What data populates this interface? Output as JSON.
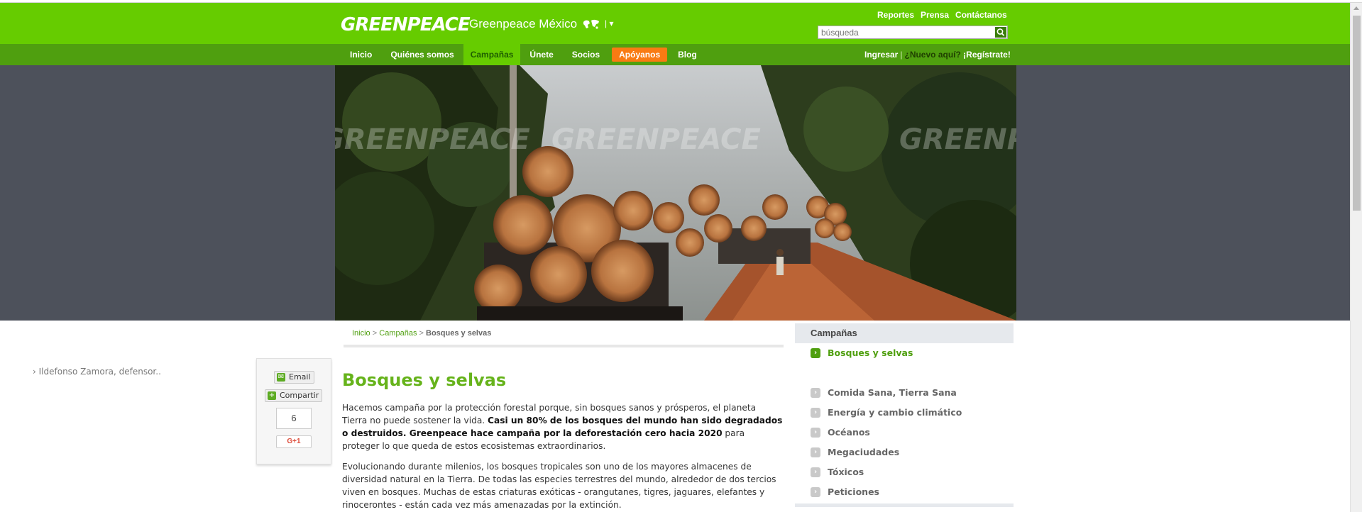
{
  "header": {
    "logo": "GREENPEACE",
    "site_name": "Greenpeace México",
    "globe_icon": "globe-icon",
    "top_links": [
      "Reportes",
      "Prensa",
      "Contáctanos"
    ],
    "search_placeholder": "búsqueda"
  },
  "nav": {
    "items": [
      "Inicio",
      "Quiénes somos",
      "Campañas",
      "Únete",
      "Socios",
      "Apóyanos",
      "Blog"
    ],
    "active": "Campañas",
    "highlight": "Apóyanos",
    "login": "Ingresar",
    "new_here": "¿Nuevo aquí?",
    "register": "¡Regístrate!"
  },
  "hero": {
    "watermark": "GREENPEACE"
  },
  "breadcrumb": {
    "items": [
      "Inicio",
      "Campañas",
      "Bosques y selvas"
    ]
  },
  "share": {
    "email_label": "Email",
    "share_label": "Compartir",
    "count": "6",
    "gplus_label": "G+1"
  },
  "article": {
    "title": "Bosques y selvas",
    "p1_a": "Hacemos campaña por la protección forestal porque, sin bosques sanos y prósperos, el planeta Tierra no puede sostener la vida. ",
    "p1_bold": "Casi un 80%  de los bosques del mundo han sido degradados o destruidos. Greenpeace hace campaña por la deforestación cero hacia 2020",
    "p1_c": " para proteger lo que queda de estos ecosistemas extraordinarios.",
    "p2": "Evolucionando durante milenios, los bosques tropicales son uno de los mayores almacenes de diversidad natural en la Tierra. De todas las especies terrestres del mundo, alrededor de dos tercios viven en bosques. Muchas de estas criaturas exóticas - orangutanes, tigres, jaguares, elefantes y rinocerontes - están cada vez más amenazadas por la extinción."
  },
  "sidebar": {
    "heading": "Campañas",
    "active_item": "Bosques y selvas",
    "sub_item": "Ildefonso Zamora, defensor..",
    "items": [
      "Comida Sana, Tierra Sana",
      "Energía y cambio climático",
      "Océanos",
      "Megaciudades",
      "Tóxicos",
      "Peticiones"
    ]
  },
  "colors": {
    "brand_green": "#66cc00",
    "nav_green": "#4f9f0f",
    "accent_orange": "#f97b13",
    "title_green": "#66b31b"
  }
}
